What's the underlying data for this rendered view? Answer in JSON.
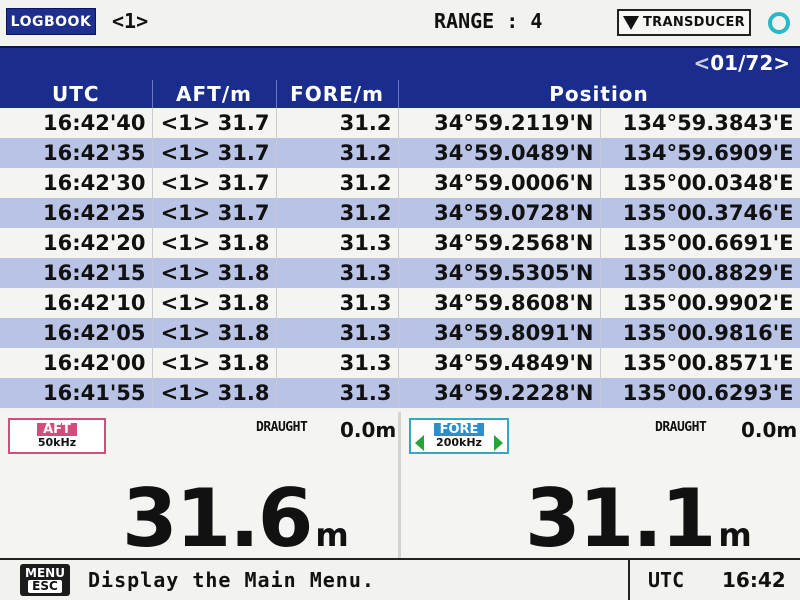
{
  "header": {
    "logbook_label": "LOGBOOK",
    "channel": "<1>",
    "range": "RANGE : 4",
    "transducer_label": "TRANSDUCER",
    "status_color": "#27b9c9"
  },
  "pager": {
    "prefix": "<",
    "page": "01/72>"
  },
  "table": {
    "columns": [
      "UTC",
      "AFT/m",
      "FORE/m",
      "Position"
    ],
    "rows": [
      {
        "utc": "16:42'40",
        "aft": "<1> 31.7",
        "fore": "31.2",
        "lat": "34°59.2119'N",
        "lon": "134°59.3843'E"
      },
      {
        "utc": "16:42'35",
        "aft": "<1> 31.7",
        "fore": "31.2",
        "lat": "34°59.0489'N",
        "lon": "134°59.6909'E"
      },
      {
        "utc": "16:42'30",
        "aft": "<1> 31.7",
        "fore": "31.2",
        "lat": "34°59.0006'N",
        "lon": "135°00.0348'E"
      },
      {
        "utc": "16:42'25",
        "aft": "<1> 31.7",
        "fore": "31.2",
        "lat": "34°59.0728'N",
        "lon": "135°00.3746'E"
      },
      {
        "utc": "16:42'20",
        "aft": "<1> 31.8",
        "fore": "31.3",
        "lat": "34°59.2568'N",
        "lon": "135°00.6691'E"
      },
      {
        "utc": "16:42'15",
        "aft": "<1> 31.8",
        "fore": "31.3",
        "lat": "34°59.5305'N",
        "lon": "135°00.8829'E"
      },
      {
        "utc": "16:42'10",
        "aft": "<1> 31.8",
        "fore": "31.3",
        "lat": "34°59.8608'N",
        "lon": "135°00.9902'E"
      },
      {
        "utc": "16:42'05",
        "aft": "<1> 31.8",
        "fore": "31.3",
        "lat": "34°59.8091'N",
        "lon": "135°00.9816'E"
      },
      {
        "utc": "16:42'00",
        "aft": "<1> 31.8",
        "fore": "31.3",
        "lat": "34°59.4849'N",
        "lon": "135°00.8571'E"
      },
      {
        "utc": "16:41'55",
        "aft": "<1> 31.8",
        "fore": "31.3",
        "lat": "34°59.2228'N",
        "lon": "135°00.6293'E"
      }
    ]
  },
  "aft_panel": {
    "badge_top": "AFT",
    "badge_bottom": "50kHz",
    "draught_label": "DRAUGHT",
    "draught_value": "0.0m",
    "depth": "31.6",
    "unit": "m",
    "badge_color": "#d24c7c"
  },
  "fore_panel": {
    "badge_top": "FORE",
    "badge_bottom": "200kHz",
    "draught_label": "DRAUGHT",
    "draught_value": "0.0m",
    "depth": "31.1",
    "unit": "m",
    "badge_color": "#2a8fd0"
  },
  "footer": {
    "menu_top": "MENU",
    "menu_bottom": "ESC",
    "message": "Display the Main Menu.",
    "utc_label": "UTC",
    "time": "16:42"
  }
}
